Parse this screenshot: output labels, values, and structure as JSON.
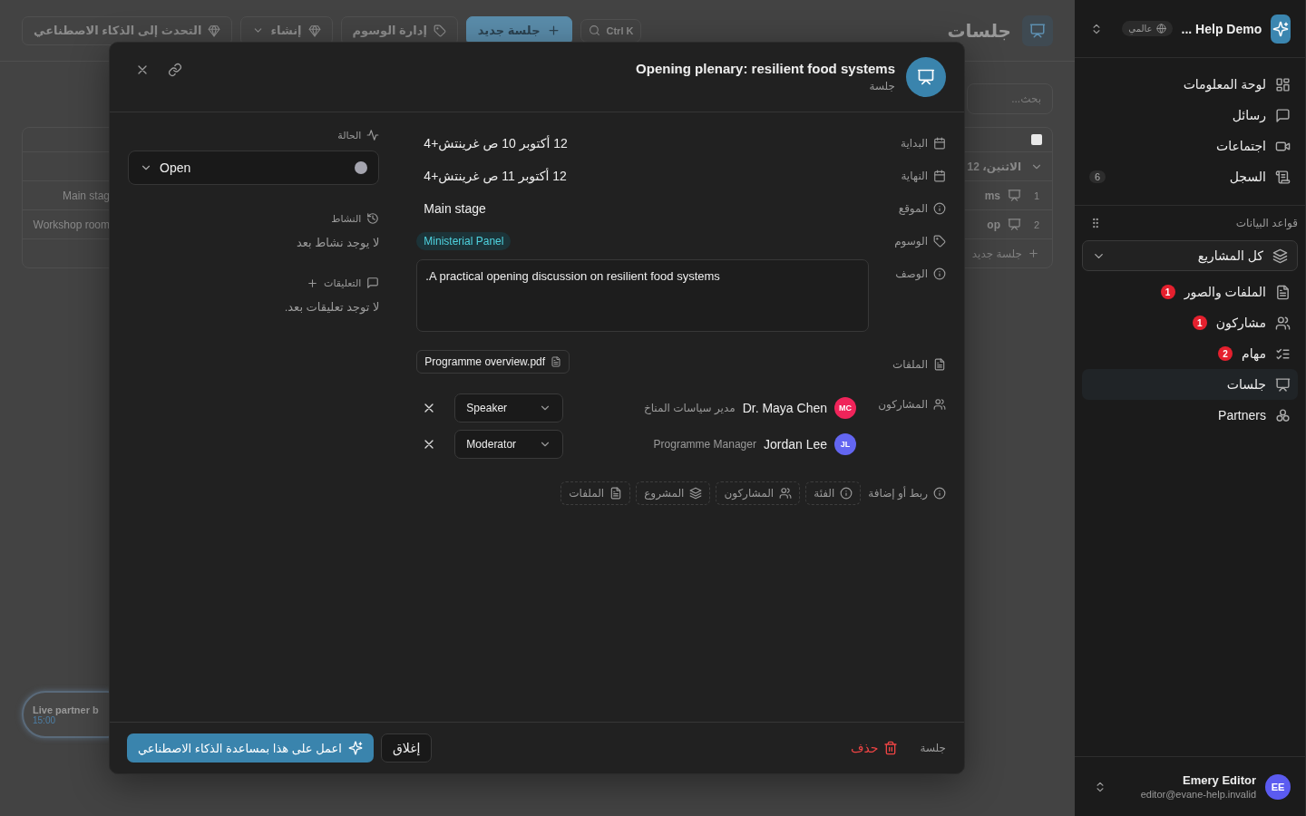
{
  "sidebar": {
    "workspace": {
      "name": "Help Demo ...",
      "scope": "عالمي"
    },
    "nav": [
      {
        "label": "لوحة المعلومات"
      },
      {
        "label": "رسائل"
      },
      {
        "label": "اجتماعات"
      },
      {
        "label": "السجل",
        "count": "6"
      }
    ],
    "databases_label": "قواعد البيانات",
    "project_filter": "كل المشاريع",
    "databases": [
      {
        "label": "الملفات والصور",
        "alerts": "1",
        "selected": false
      },
      {
        "label": "مشاركون",
        "alerts": "1",
        "selected": false
      },
      {
        "label": "مهام",
        "alerts": "2",
        "selected": false
      },
      {
        "label": "جلسات",
        "selected": true
      },
      {
        "label": "Partners",
        "selected": false
      }
    ],
    "user": {
      "initials": "EE",
      "name": "Emery Editor",
      "email": "editor@evane-help.invalid"
    }
  },
  "page": {
    "title": "جلسات",
    "toolbar": [
      {
        "label": "Ctrl K",
        "kind": "search"
      },
      {
        "label": "جلسة جديد",
        "kind": "primary"
      },
      {
        "label": "إدارة الوسوم",
        "kind": "tags"
      },
      {
        "label": "إنشاء",
        "kind": "menu"
      },
      {
        "label": "التحدث إلى الذكاء الاصطناعي",
        "kind": "plain"
      }
    ],
    "search": {
      "placeholder": "بحث..."
    },
    "table": {
      "checked": false,
      "group": "الاثنين، 12",
      "rows": [
        {
          "number": "1",
          "title": "ms",
          "location": "Main stag"
        },
        {
          "number": "2",
          "title": "op",
          "location": "Workshop room"
        }
      ],
      "add_row": "جلسة جديد"
    },
    "card": {
      "title": "Live partner b",
      "time": "15:00"
    }
  },
  "dialog": {
    "title": "Opening plenary: resilient food systems",
    "subtitle": "جلسة",
    "fields": [
      {
        "kind": "text",
        "label": "البداية",
        "value": "12 أكتوبر 10 ص غرينتش+4"
      },
      {
        "kind": "text",
        "label": "النهاية",
        "value": "12 أكتوبر 11 ص غرينتش+4"
      },
      {
        "kind": "text",
        "label": "الموقع",
        "value": "Main stage"
      },
      {
        "kind": "tags",
        "label": "الوسوم",
        "tags": [
          "Ministerial Panel"
        ]
      },
      {
        "kind": "textarea",
        "label": "الوصف",
        "value": ".A practical opening discussion on resilient food systems"
      },
      {
        "kind": "files",
        "label": "الملفات",
        "files": [
          "Programme overview.pdf"
        ]
      },
      {
        "kind": "people",
        "label": "المشاركون",
        "people": [
          {
            "initials": "MC",
            "name": "Dr. Maya Chen",
            "title": "مدير سياسات المناخ",
            "role": "Speaker",
            "color": "#f0245a"
          },
          {
            "initials": "JL",
            "name": "Jordan Lee",
            "title": "Programme Manager",
            "role": "Moderator",
            "color": "#6366f1"
          }
        ]
      }
    ],
    "links": {
      "label": "ربط أو إضافة",
      "chips": [
        "الفئة",
        "المشاركون",
        "المشروع",
        "الملفات"
      ]
    },
    "status": {
      "label": "الحالة",
      "value": "Open"
    },
    "activity": {
      "label": "النشاط",
      "empty": "لا يوجد نشاط بعد"
    },
    "comments": {
      "label": "التعليقات",
      "empty": "لا توجد تعليقات بعد."
    },
    "footer": {
      "type": "جلسة",
      "delete": "حذف",
      "close": "إغلاق",
      "ai": "اعمل على هذا بمساعدة الذكاء الاصطناعي"
    }
  }
}
